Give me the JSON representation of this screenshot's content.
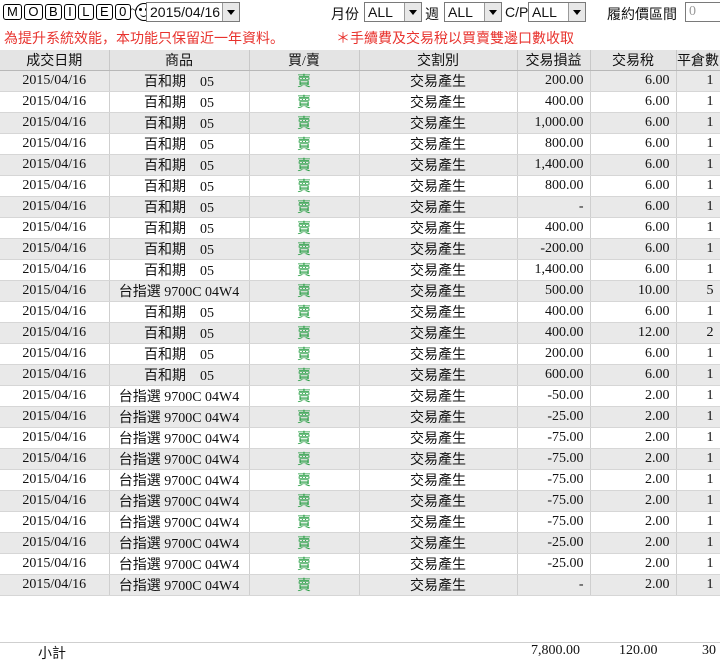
{
  "toolbar": {
    "logo_text": "MOBILE01",
    "tilde": "~",
    "date_value": "2015/04/16",
    "month_label": "月份",
    "month_value": "ALL",
    "week_label": "週",
    "week_value": "ALL",
    "cp_label": "C/P",
    "cp_value": "ALL",
    "price_range_label": "履約價區間",
    "price_range_value": "0"
  },
  "notice": {
    "left": "為提升系統效能，本功能只保留近一年資料。",
    "right": "＊手續費及交易稅以買賣雙邊口數收取"
  },
  "table": {
    "headers": [
      "成交日期",
      "商品",
      "買/賣",
      "交割別",
      "交易損益",
      "交易稅",
      "平倉數"
    ],
    "rows": [
      [
        "2015/04/16",
        "百和期　05",
        "賣",
        "交易產生",
        "200.00",
        "6.00",
        "1"
      ],
      [
        "2015/04/16",
        "百和期　05",
        "賣",
        "交易產生",
        "400.00",
        "6.00",
        "1"
      ],
      [
        "2015/04/16",
        "百和期　05",
        "賣",
        "交易產生",
        "1,000.00",
        "6.00",
        "1"
      ],
      [
        "2015/04/16",
        "百和期　05",
        "賣",
        "交易產生",
        "800.00",
        "6.00",
        "1"
      ],
      [
        "2015/04/16",
        "百和期　05",
        "賣",
        "交易產生",
        "1,400.00",
        "6.00",
        "1"
      ],
      [
        "2015/04/16",
        "百和期　05",
        "賣",
        "交易產生",
        "800.00",
        "6.00",
        "1"
      ],
      [
        "2015/04/16",
        "百和期　05",
        "賣",
        "交易產生",
        "-",
        "6.00",
        "1"
      ],
      [
        "2015/04/16",
        "百和期　05",
        "賣",
        "交易產生",
        "400.00",
        "6.00",
        "1"
      ],
      [
        "2015/04/16",
        "百和期　05",
        "賣",
        "交易產生",
        "-200.00",
        "6.00",
        "1"
      ],
      [
        "2015/04/16",
        "百和期　05",
        "賣",
        "交易產生",
        "1,400.00",
        "6.00",
        "1"
      ],
      [
        "2015/04/16",
        "台指選 9700C 04W4",
        "賣",
        "交易產生",
        "500.00",
        "10.00",
        "5"
      ],
      [
        "2015/04/16",
        "百和期　05",
        "賣",
        "交易產生",
        "400.00",
        "6.00",
        "1"
      ],
      [
        "2015/04/16",
        "百和期　05",
        "賣",
        "交易產生",
        "400.00",
        "12.00",
        "2"
      ],
      [
        "2015/04/16",
        "百和期　05",
        "賣",
        "交易產生",
        "200.00",
        "6.00",
        "1"
      ],
      [
        "2015/04/16",
        "百和期　05",
        "賣",
        "交易產生",
        "600.00",
        "6.00",
        "1"
      ],
      [
        "2015/04/16",
        "台指選 9700C 04W4",
        "賣",
        "交易產生",
        "-50.00",
        "2.00",
        "1"
      ],
      [
        "2015/04/16",
        "台指選 9700C 04W4",
        "賣",
        "交易產生",
        "-25.00",
        "2.00",
        "1"
      ],
      [
        "2015/04/16",
        "台指選 9700C 04W4",
        "賣",
        "交易產生",
        "-75.00",
        "2.00",
        "1"
      ],
      [
        "2015/04/16",
        "台指選 9700C 04W4",
        "賣",
        "交易產生",
        "-75.00",
        "2.00",
        "1"
      ],
      [
        "2015/04/16",
        "台指選 9700C 04W4",
        "賣",
        "交易產生",
        "-75.00",
        "2.00",
        "1"
      ],
      [
        "2015/04/16",
        "台指選 9700C 04W4",
        "賣",
        "交易產生",
        "-75.00",
        "2.00",
        "1"
      ],
      [
        "2015/04/16",
        "台指選 9700C 04W4",
        "賣",
        "交易產生",
        "-75.00",
        "2.00",
        "1"
      ],
      [
        "2015/04/16",
        "台指選 9700C 04W4",
        "賣",
        "交易產生",
        "-25.00",
        "2.00",
        "1"
      ],
      [
        "2015/04/16",
        "台指選 9700C 04W4",
        "賣",
        "交易產生",
        "-25.00",
        "2.00",
        "1"
      ],
      [
        "2015/04/16",
        "台指選 9700C 04W4",
        "賣",
        "交易產生",
        "-",
        "2.00",
        "1"
      ]
    ]
  },
  "footer": {
    "subtotal_label": "小計",
    "pnl_total": "7,800.00",
    "tax_total": "120.00",
    "count_total": "30"
  },
  "colors": {
    "notice_red": "#e8322d",
    "sell_green": "#1f9a3c",
    "header_bg": "#e4e4e4",
    "odd_row_bg": "#e9e9e9"
  }
}
